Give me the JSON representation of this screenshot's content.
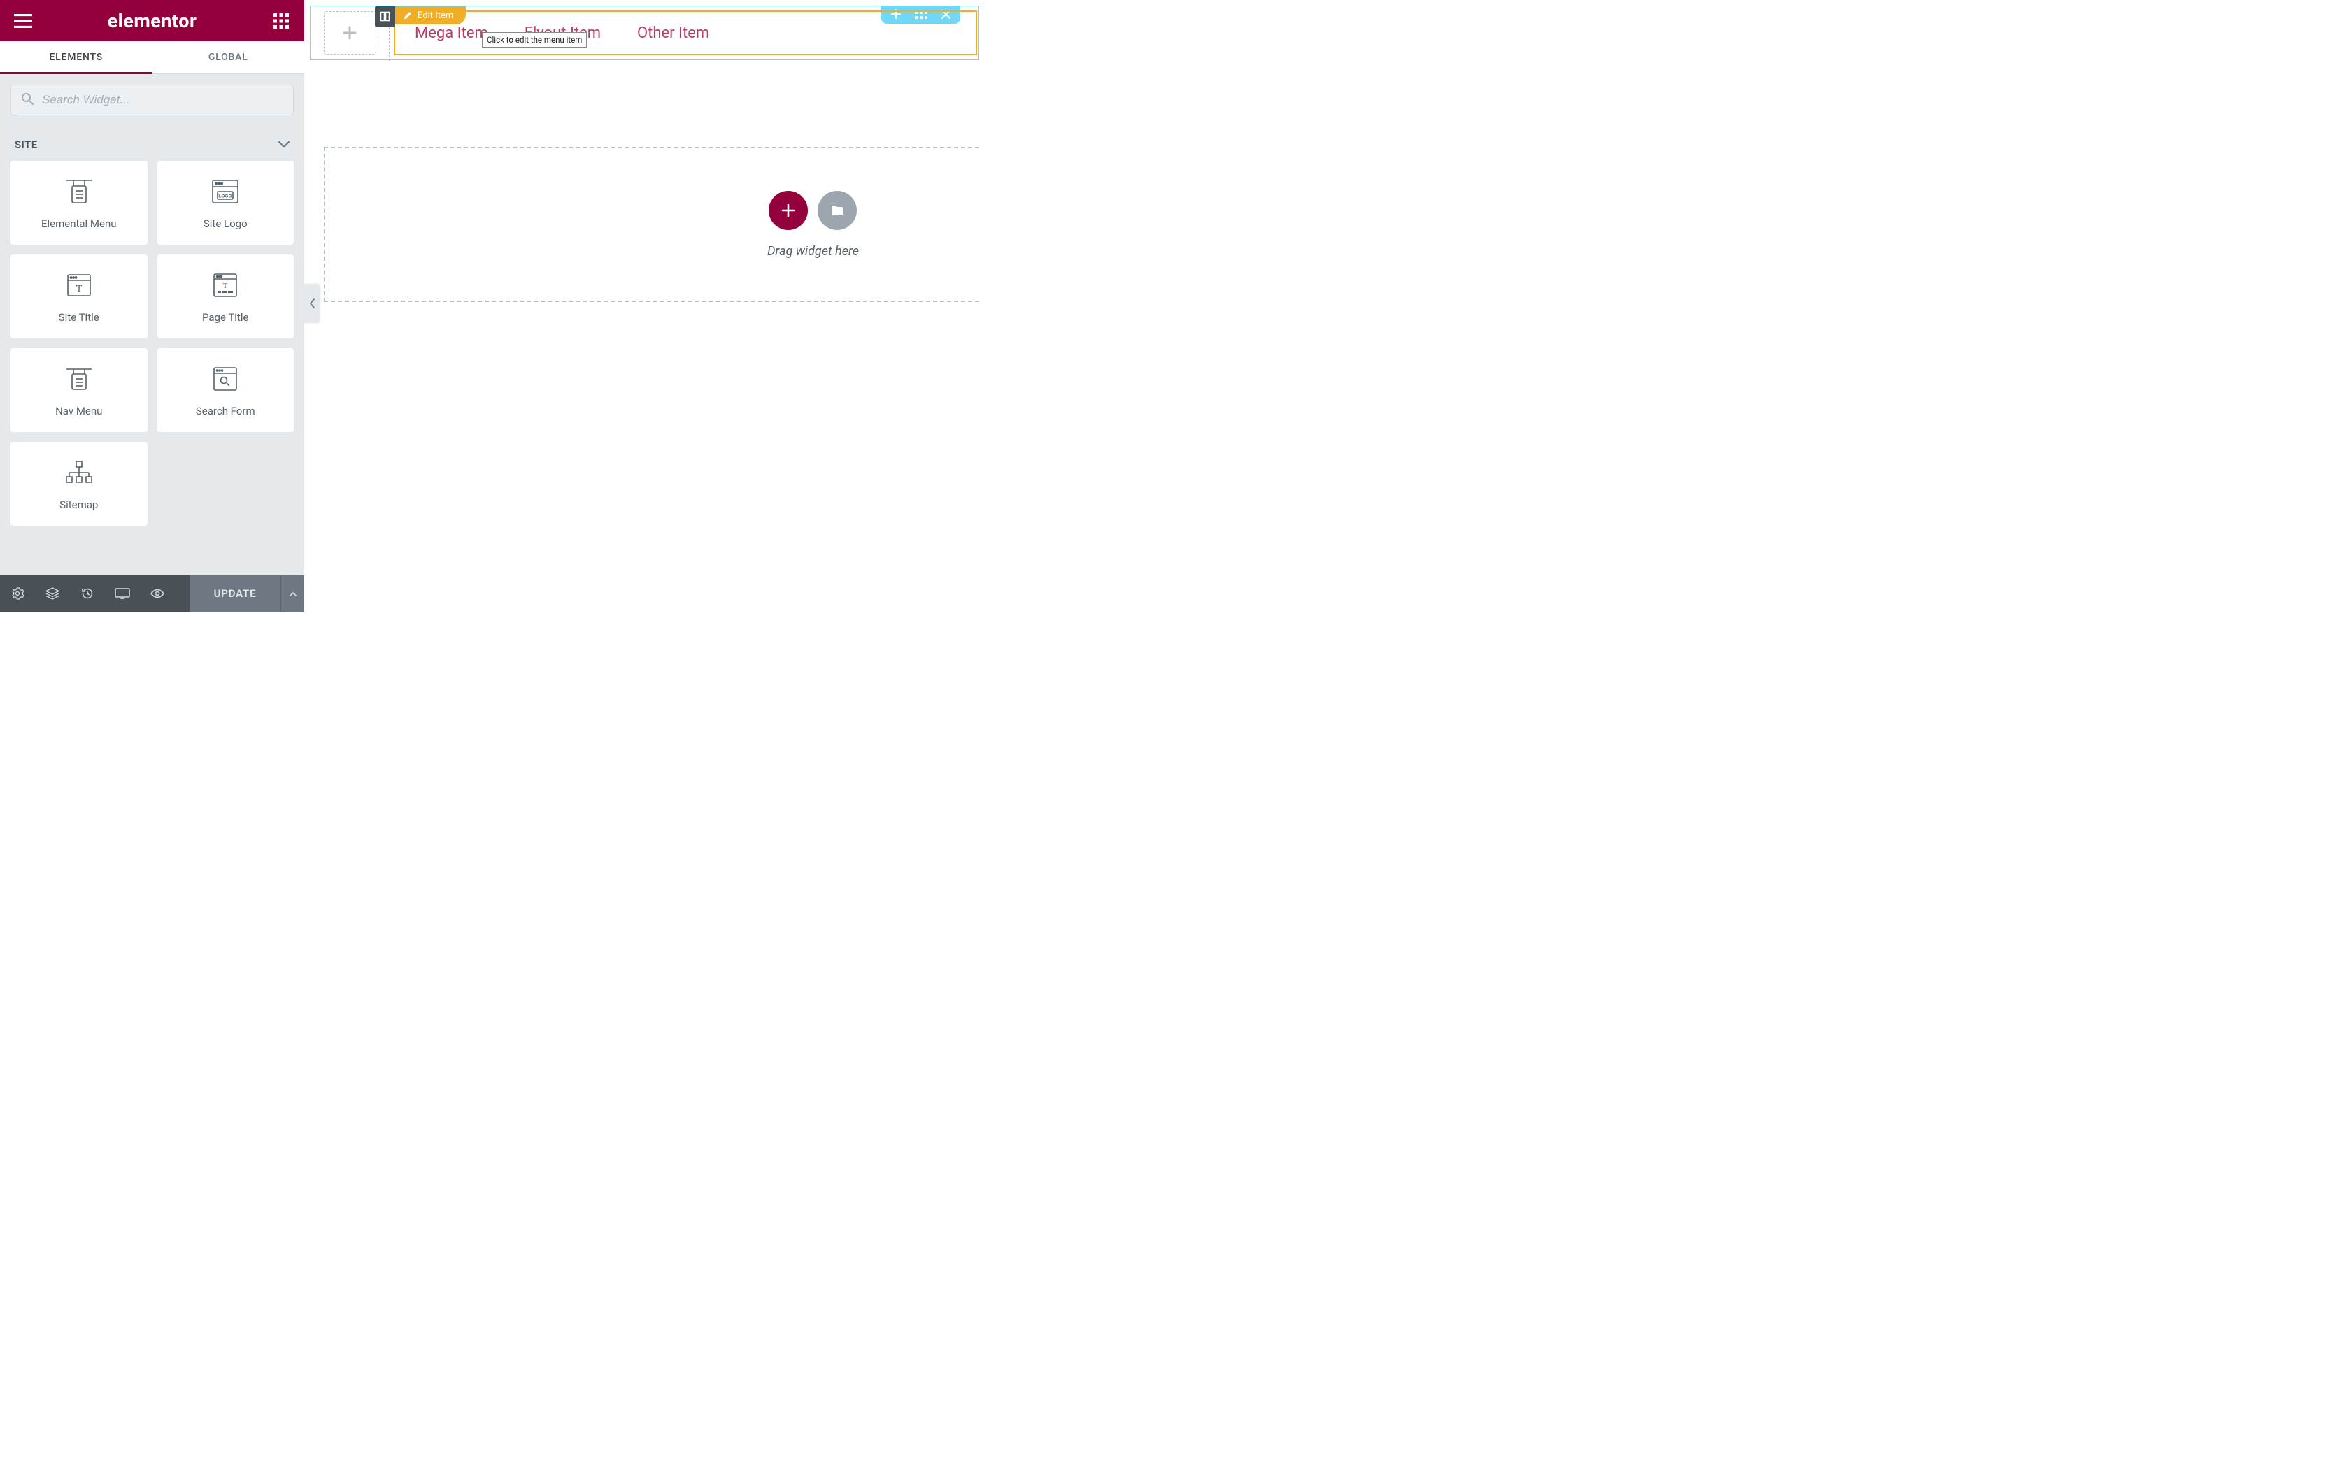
{
  "header": {
    "brand": "elementor"
  },
  "tabs": {
    "elements": "ELEMENTS",
    "global": "GLOBAL"
  },
  "search": {
    "placeholder": "Search Widget..."
  },
  "category": {
    "title": "SITE"
  },
  "widgets": [
    {
      "name": "elemental-menu",
      "label": "Elemental Menu"
    },
    {
      "name": "site-logo",
      "label": "Site Logo"
    },
    {
      "name": "site-title",
      "label": "Site Title"
    },
    {
      "name": "page-title",
      "label": "Page Title"
    },
    {
      "name": "nav-menu",
      "label": "Nav Menu"
    },
    {
      "name": "search-form",
      "label": "Search Form"
    },
    {
      "name": "sitemap",
      "label": "Sitemap"
    }
  ],
  "footer": {
    "update_label": "UPDATE"
  },
  "canvas": {
    "edit_tag": "Edit Item",
    "tooltip": "Click to edit the menu item",
    "nav_items": [
      "Mega Item",
      "Flyout Item",
      "Other Item"
    ],
    "drop_text": "Drag widget here"
  },
  "icons": {
    "hamburger": "hamburger-icon",
    "apps": "apps-icon"
  }
}
